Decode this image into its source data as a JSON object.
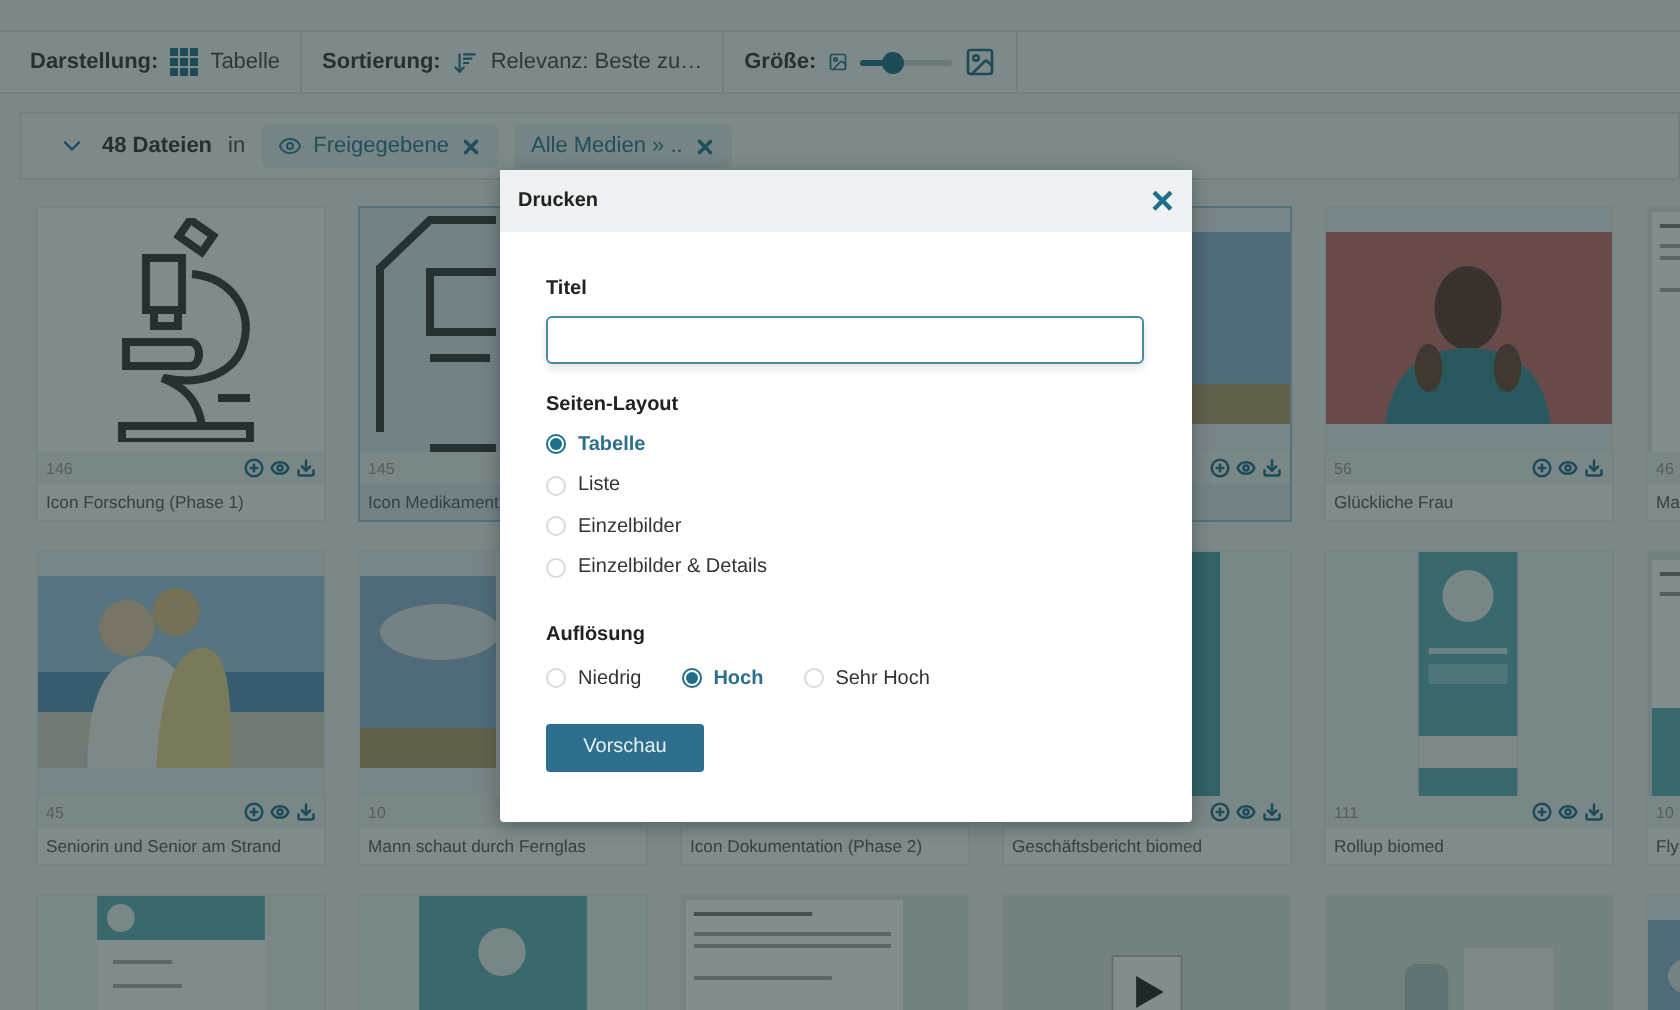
{
  "toolbar": {
    "view_label": "Darstellung:",
    "view_value": "Tabelle",
    "sort_label": "Sortierung:",
    "sort_value": "Relevanz: Beste zu…",
    "size_label": "Größe:",
    "size": {
      "level": 0.35
    }
  },
  "filter": {
    "count": "48 Dateien",
    "in": "in",
    "chips": [
      {
        "label": "Freigegebene",
        "kind": "eye"
      },
      {
        "label": "Alle Medien » ..",
        "kind": "plain"
      }
    ]
  },
  "cards": [
    {
      "kind": "microscope",
      "number": "146",
      "caption": "Icon Forschung (Phase 1)",
      "actions": true,
      "selected": false
    },
    {
      "kind": "document",
      "number": "145",
      "caption": "Icon Medikament",
      "selected": true
    },
    {
      "kind": "covered"
    },
    {
      "kind": "photo-sky",
      "actions": true,
      "selected": true
    },
    {
      "kind": "photo-red",
      "number": "56",
      "caption": "Glückliche Frau",
      "actions": true,
      "selected": false
    },
    {
      "kind": "doc-text",
      "number": "46",
      "caption": "Ma",
      "selected": false
    },
    {
      "kind": "photo-beach",
      "number": "45",
      "caption": "Seniorin und Senior am Strand",
      "actions": true,
      "selected": false
    },
    {
      "kind": "photo-sky",
      "number": "10",
      "caption": "Mann schaut durch Fernglas",
      "selected": false
    },
    {
      "kind": "blank",
      "caption": "Icon Dokumentation (Phase 2)",
      "selected": false
    },
    {
      "kind": "teal-panel",
      "caption": "Geschäftsbericht biomed",
      "actions": true,
      "selected": false
    },
    {
      "kind": "rollup",
      "number": "111",
      "caption": "Rollup biomed",
      "actions": true,
      "selected": false
    },
    {
      "kind": "flyer",
      "number": "10",
      "caption": "Fly",
      "selected": false
    },
    {
      "kind": "doc-header",
      "selected": false
    },
    {
      "kind": "teal-square",
      "selected": false
    },
    {
      "kind": "doc-text",
      "selected": false
    },
    {
      "kind": "video",
      "selected": false
    },
    {
      "kind": "product",
      "selected": false
    },
    {
      "kind": "photo-sky",
      "selected": false
    }
  ],
  "dialog": {
    "title": "Drucken",
    "close": "×",
    "title_label": "Titel",
    "layout_label": "Seiten-Layout",
    "layouts": [
      {
        "label": "Tabelle",
        "selected": true
      },
      {
        "label": "Liste",
        "selected": false
      },
      {
        "label": "Einzelbilder",
        "selected": false
      },
      {
        "label": "Einzelbilder & Details",
        "selected": false
      }
    ],
    "resolution_label": "Auflösung",
    "resolutions": [
      {
        "label": "Niedrig",
        "selected": false
      },
      {
        "label": "Hoch",
        "selected": true
      },
      {
        "label": "Sehr Hoch",
        "selected": false
      }
    ],
    "button": "Vorschau"
  }
}
